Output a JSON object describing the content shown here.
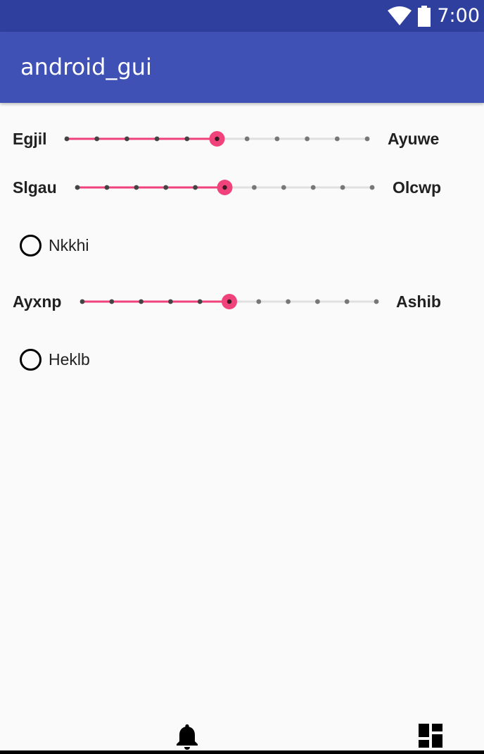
{
  "status_bar": {
    "time": "7:00",
    "wifi_icon": "wifi-icon",
    "battery_icon": "battery-icon"
  },
  "app_bar": {
    "title": "android_gui"
  },
  "colors": {
    "status_bar": "#2f3f9e",
    "app_bar": "#3f51b5",
    "accent": "#f0437c",
    "background": "#fafafa"
  },
  "controls": {
    "slider1": {
      "start_label": "Egjil",
      "end_label": "Ayuwe",
      "steps": 10,
      "value": 5
    },
    "slider2": {
      "start_label": "Slgau",
      "end_label": "Olcwp",
      "steps": 10,
      "value": 5
    },
    "radio1": {
      "label": "Nkkhi",
      "checked": false
    },
    "slider3": {
      "start_label": "Ayxnp",
      "end_label": "Ashib",
      "steps": 10,
      "value": 5
    },
    "radio2": {
      "label": "Heklb",
      "checked": false
    }
  },
  "bottom_bar": {
    "left_icon": "bell-icon",
    "right_icon": "dashboard-icon"
  }
}
